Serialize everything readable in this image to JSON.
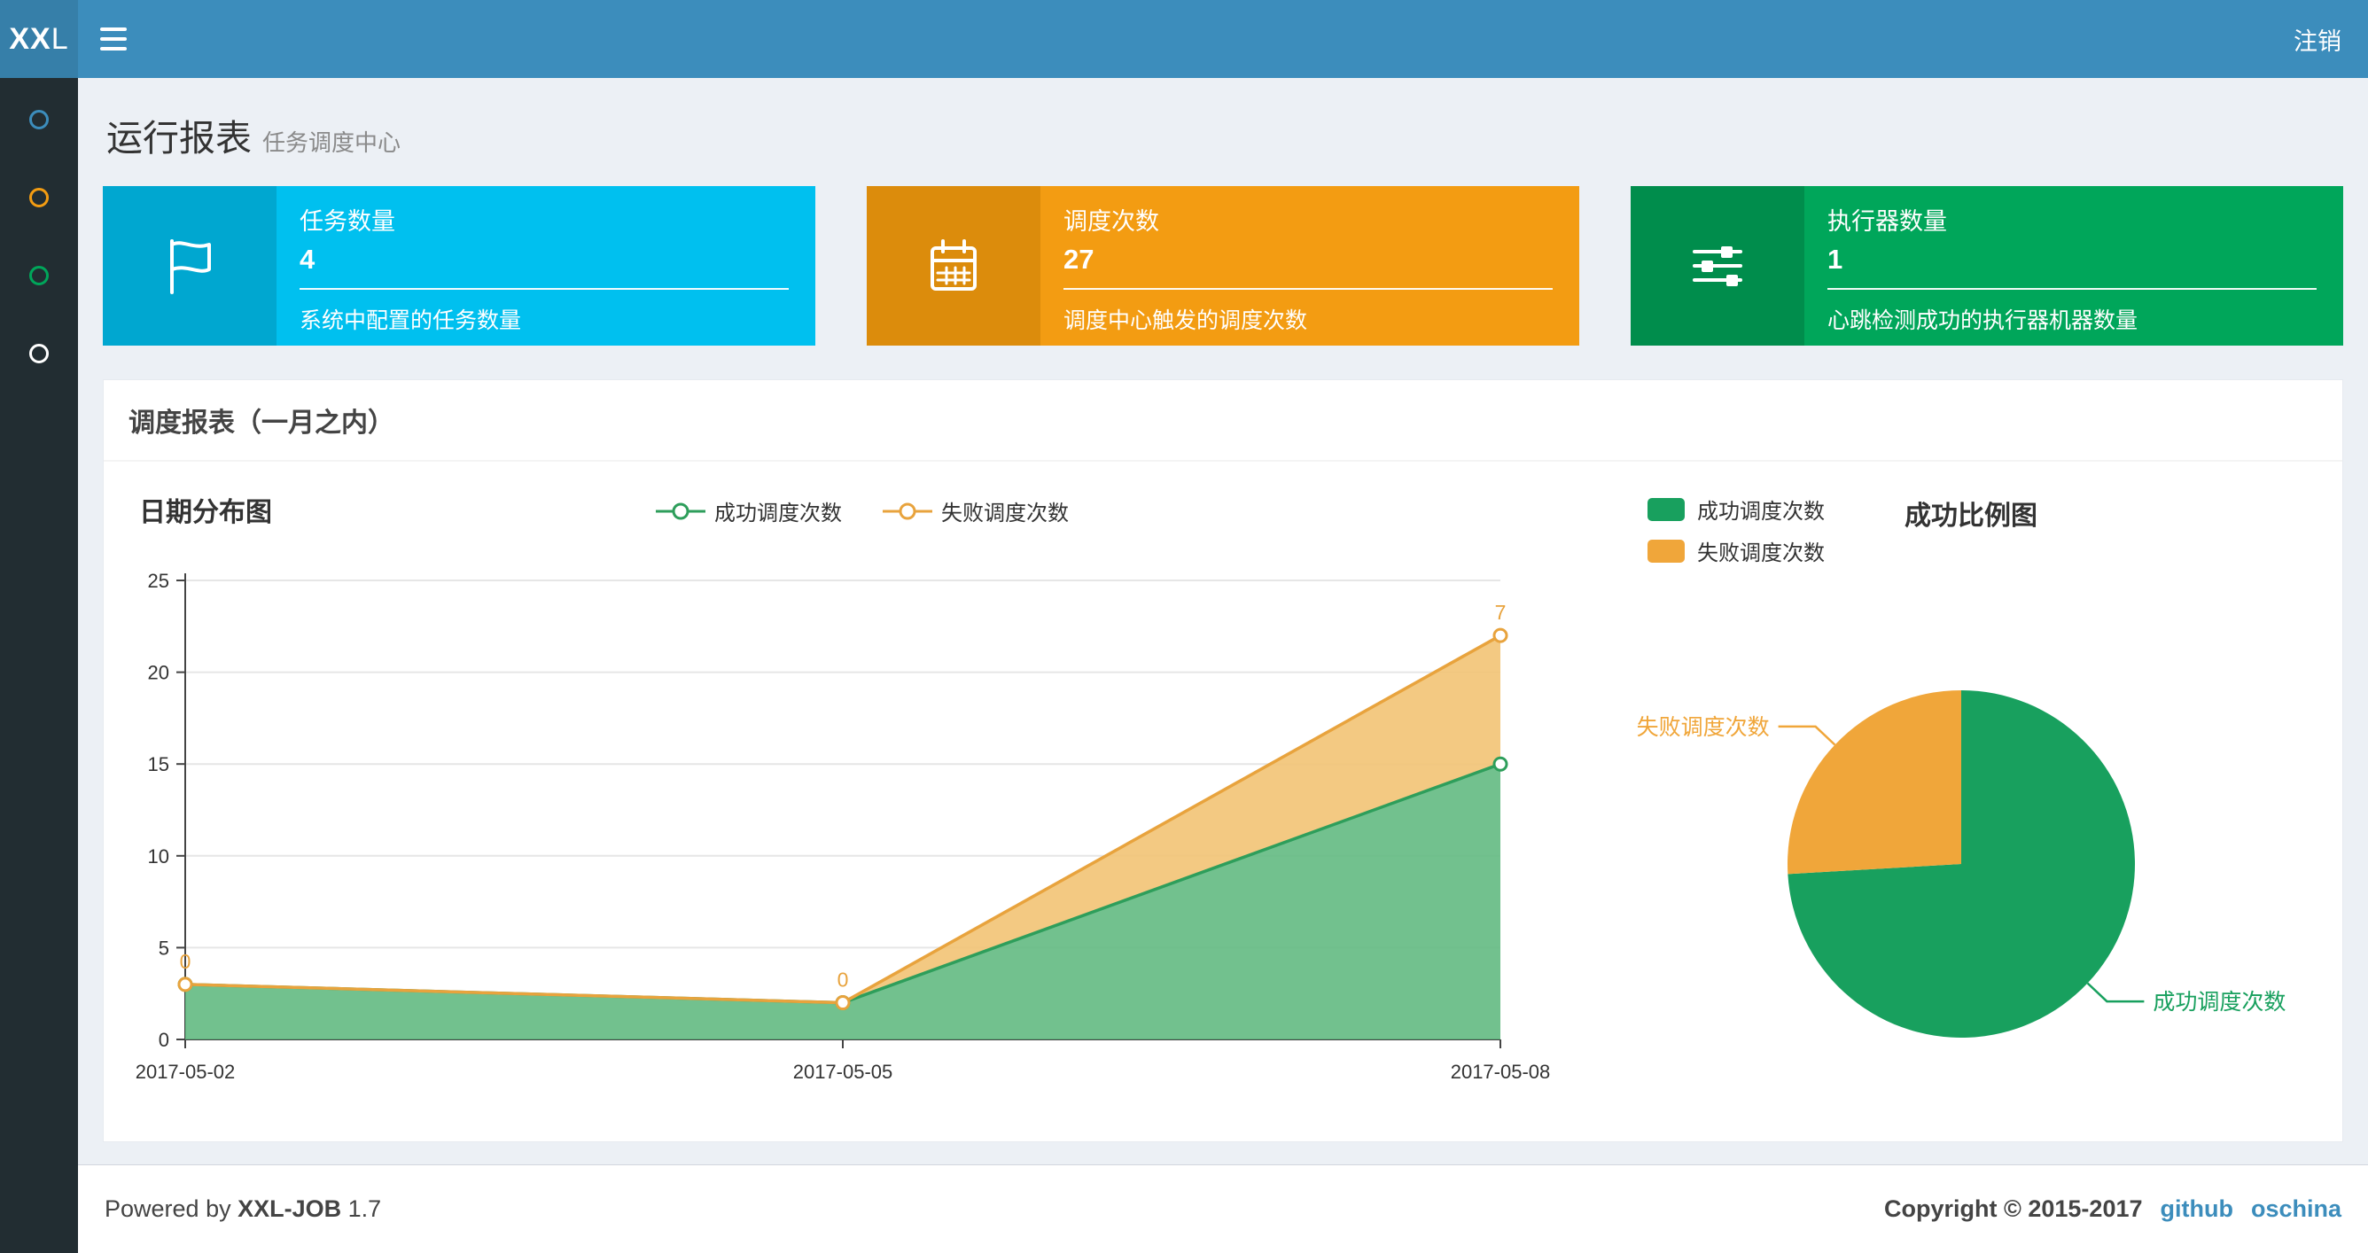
{
  "navbar": {
    "logo_bold": "XX",
    "logo_light": "L",
    "logout": "注销"
  },
  "sidebar": {
    "dot_colors": [
      "#3c8dbc",
      "#f39c12",
      "#00a65a",
      "#ffffff"
    ]
  },
  "header": {
    "title": "运行报表",
    "subtitle": "任务调度中心"
  },
  "info_boxes": [
    {
      "label": "任务数量",
      "value": "4",
      "desc": "系统中配置的任务数量",
      "color": "#00c0ef",
      "icon_bg": "#00a7d0",
      "icon": "flag-icon"
    },
    {
      "label": "调度次数",
      "value": "27",
      "desc": "调度中心触发的调度次数",
      "color": "#f39c12",
      "icon_bg": "#dc8c0c",
      "icon": "calendar-icon"
    },
    {
      "label": "执行器数量",
      "value": "1",
      "desc": "心跳检测成功的执行器机器数量",
      "color": "#00a65a",
      "icon_bg": "#008d4c",
      "icon": "sliders-icon"
    }
  ],
  "panel": {
    "title": "调度报表（一月之内）"
  },
  "chart_data": [
    {
      "type": "area",
      "title": "日期分布图",
      "x": [
        "2017-05-02",
        "2017-05-05",
        "2017-05-08"
      ],
      "series": [
        {
          "name": "成功调度次数",
          "values": [
            3,
            2,
            15
          ],
          "color": "#2E9E5B",
          "fill": "#63BA82"
        },
        {
          "name": "失败调度次数",
          "values": [
            0,
            0,
            7
          ],
          "color": "#E8A33D",
          "fill": "#F2C374",
          "show_labels": true
        }
      ],
      "stacked": true,
      "ylim": [
        0,
        25
      ],
      "yticks": [
        0,
        5,
        10,
        15,
        20,
        25
      ],
      "legend_position": "top-center",
      "grid": "horizontal"
    },
    {
      "type": "pie",
      "title": "成功比例图",
      "slices": [
        {
          "label": "成功调度次数",
          "value": 20,
          "color": "#18A05E"
        },
        {
          "label": "失败调度次数",
          "value": 7,
          "color": "#F0A63A"
        }
      ],
      "legend_position": "top-left"
    }
  ],
  "footer": {
    "powered": "Powered by",
    "brand": "XXL-JOB",
    "version": "1.7",
    "copyright": "Copyright © 2015-2017",
    "links": [
      {
        "label": "github"
      },
      {
        "label": "oschina"
      }
    ],
    "link_color": "#3c8dbc"
  }
}
